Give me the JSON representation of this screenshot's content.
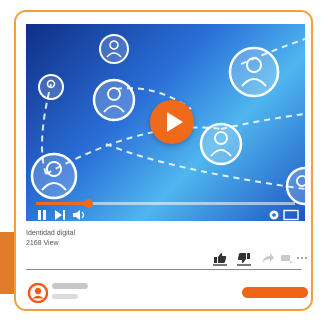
{
  "video": {
    "title": "Identidad digital",
    "views": "2168 View",
    "progress_fraction": 0.2
  },
  "icons": {
    "play": "play-icon",
    "pause": "pause-icon",
    "next": "skip-next-icon",
    "volume": "volume-icon",
    "settings": "gear-icon",
    "fullscreen": "fullscreen-icon",
    "like": "thumbs-up-icon",
    "dislike": "thumbs-down-icon",
    "share": "share-icon",
    "playlist": "playlist-add-icon",
    "more": "more-horizontal-icon",
    "avatar": "user-avatar-icon"
  },
  "colors": {
    "accent": "#ef6a1a",
    "card_border": "#f0a13c",
    "side_tab": "#e07b2a"
  }
}
